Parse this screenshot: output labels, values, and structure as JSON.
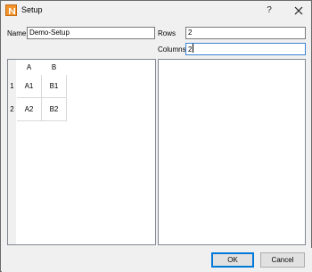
{
  "window": {
    "title": "Setup",
    "help_glyph": "?",
    "app_icon": "n-logo-icon",
    "close_icon": "close-icon"
  },
  "form": {
    "name_label": "Name",
    "name_value": "Demo-Setup",
    "rows_label": "Rows",
    "rows_value": "2",
    "columns_label": "Columns",
    "columns_value": "2"
  },
  "grid": {
    "column_headers": [
      "A",
      "B"
    ],
    "row_headers": [
      "1",
      "2"
    ],
    "cells": [
      [
        "A1",
        "B1"
      ],
      [
        "A2",
        "B2"
      ]
    ]
  },
  "buttons": {
    "ok_label": "OK",
    "cancel_label": "Cancel"
  },
  "colors": {
    "focus_border": "#3a84d6",
    "default_button_border": "#0078d7",
    "app_icon_orange": "#f2932c"
  }
}
